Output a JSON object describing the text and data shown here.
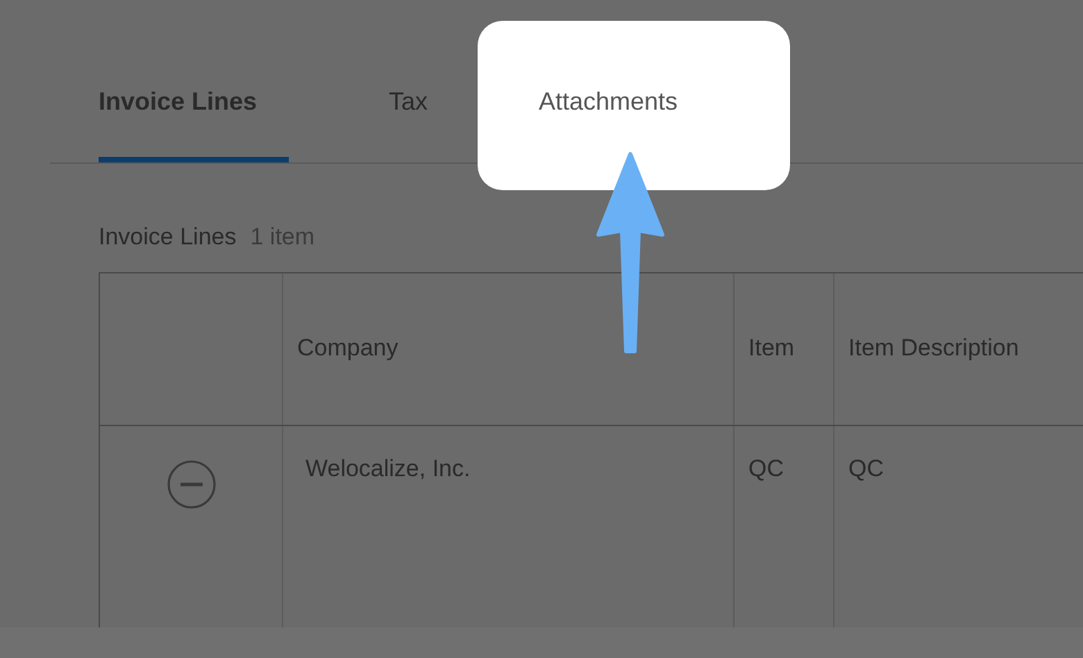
{
  "tabs": [
    {
      "label": "Invoice Lines",
      "selected": true,
      "highlighted": false
    },
    {
      "label": "Tax",
      "selected": false,
      "highlighted": false
    },
    {
      "label": "Attachments",
      "selected": false,
      "highlighted": true
    }
  ],
  "section": {
    "title": "Invoice Lines",
    "count": "1 item"
  },
  "table": {
    "columns": [
      "Company",
      "Item",
      "Item Description"
    ],
    "rows": [
      {
        "cells": [
          "Welocalize, Inc.",
          "QC",
          "QC"
        ]
      }
    ]
  }
}
